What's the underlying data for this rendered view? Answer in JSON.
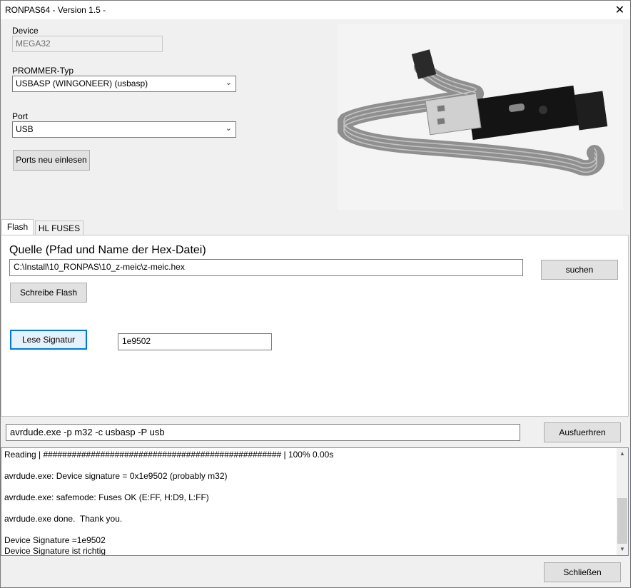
{
  "window": {
    "title": "RONPAS64 - Version 1.5 -",
    "close_icon": "close-icon"
  },
  "device": {
    "label": "Device",
    "value": "MEGA32"
  },
  "prommer": {
    "label": "PROMMER-Typ",
    "selected": "USBASP (WINGONEER) (usbasp)"
  },
  "port": {
    "label": "Port",
    "selected": "USB"
  },
  "buttons": {
    "reload_ports": "Ports neu einlesen",
    "search": "suchen",
    "write_flash": "Schreibe Flash",
    "read_signature": "Lese Signatur",
    "execute": "Ausfuerhren",
    "close": "Schließen"
  },
  "tabs": [
    {
      "label": "Flash",
      "active": true
    },
    {
      "label": "HL FUSES",
      "active": false
    }
  ],
  "flash": {
    "source_label": "Quelle (Pfad und Name der Hex-Datei)",
    "source_path": "C:\\Install\\10_RONPAS\\10_z-meic\\z-meic.hex",
    "signature_value": "1e9502"
  },
  "command": {
    "value": "avrdude.exe -p m32 -c usbasp -P usb"
  },
  "log": [
    "Reading | ################################################## | 100% 0.00s",
    "",
    "avrdude.exe: Device signature = 0x1e9502 (probably m32)",
    "",
    "avrdude.exe: safemode: Fuses OK (E:FF, H:D9, L:FF)",
    "",
    "avrdude.exe done.  Thank you.",
    "",
    "Device Signature =1e9502",
    "Device Signature ist richtig"
  ]
}
